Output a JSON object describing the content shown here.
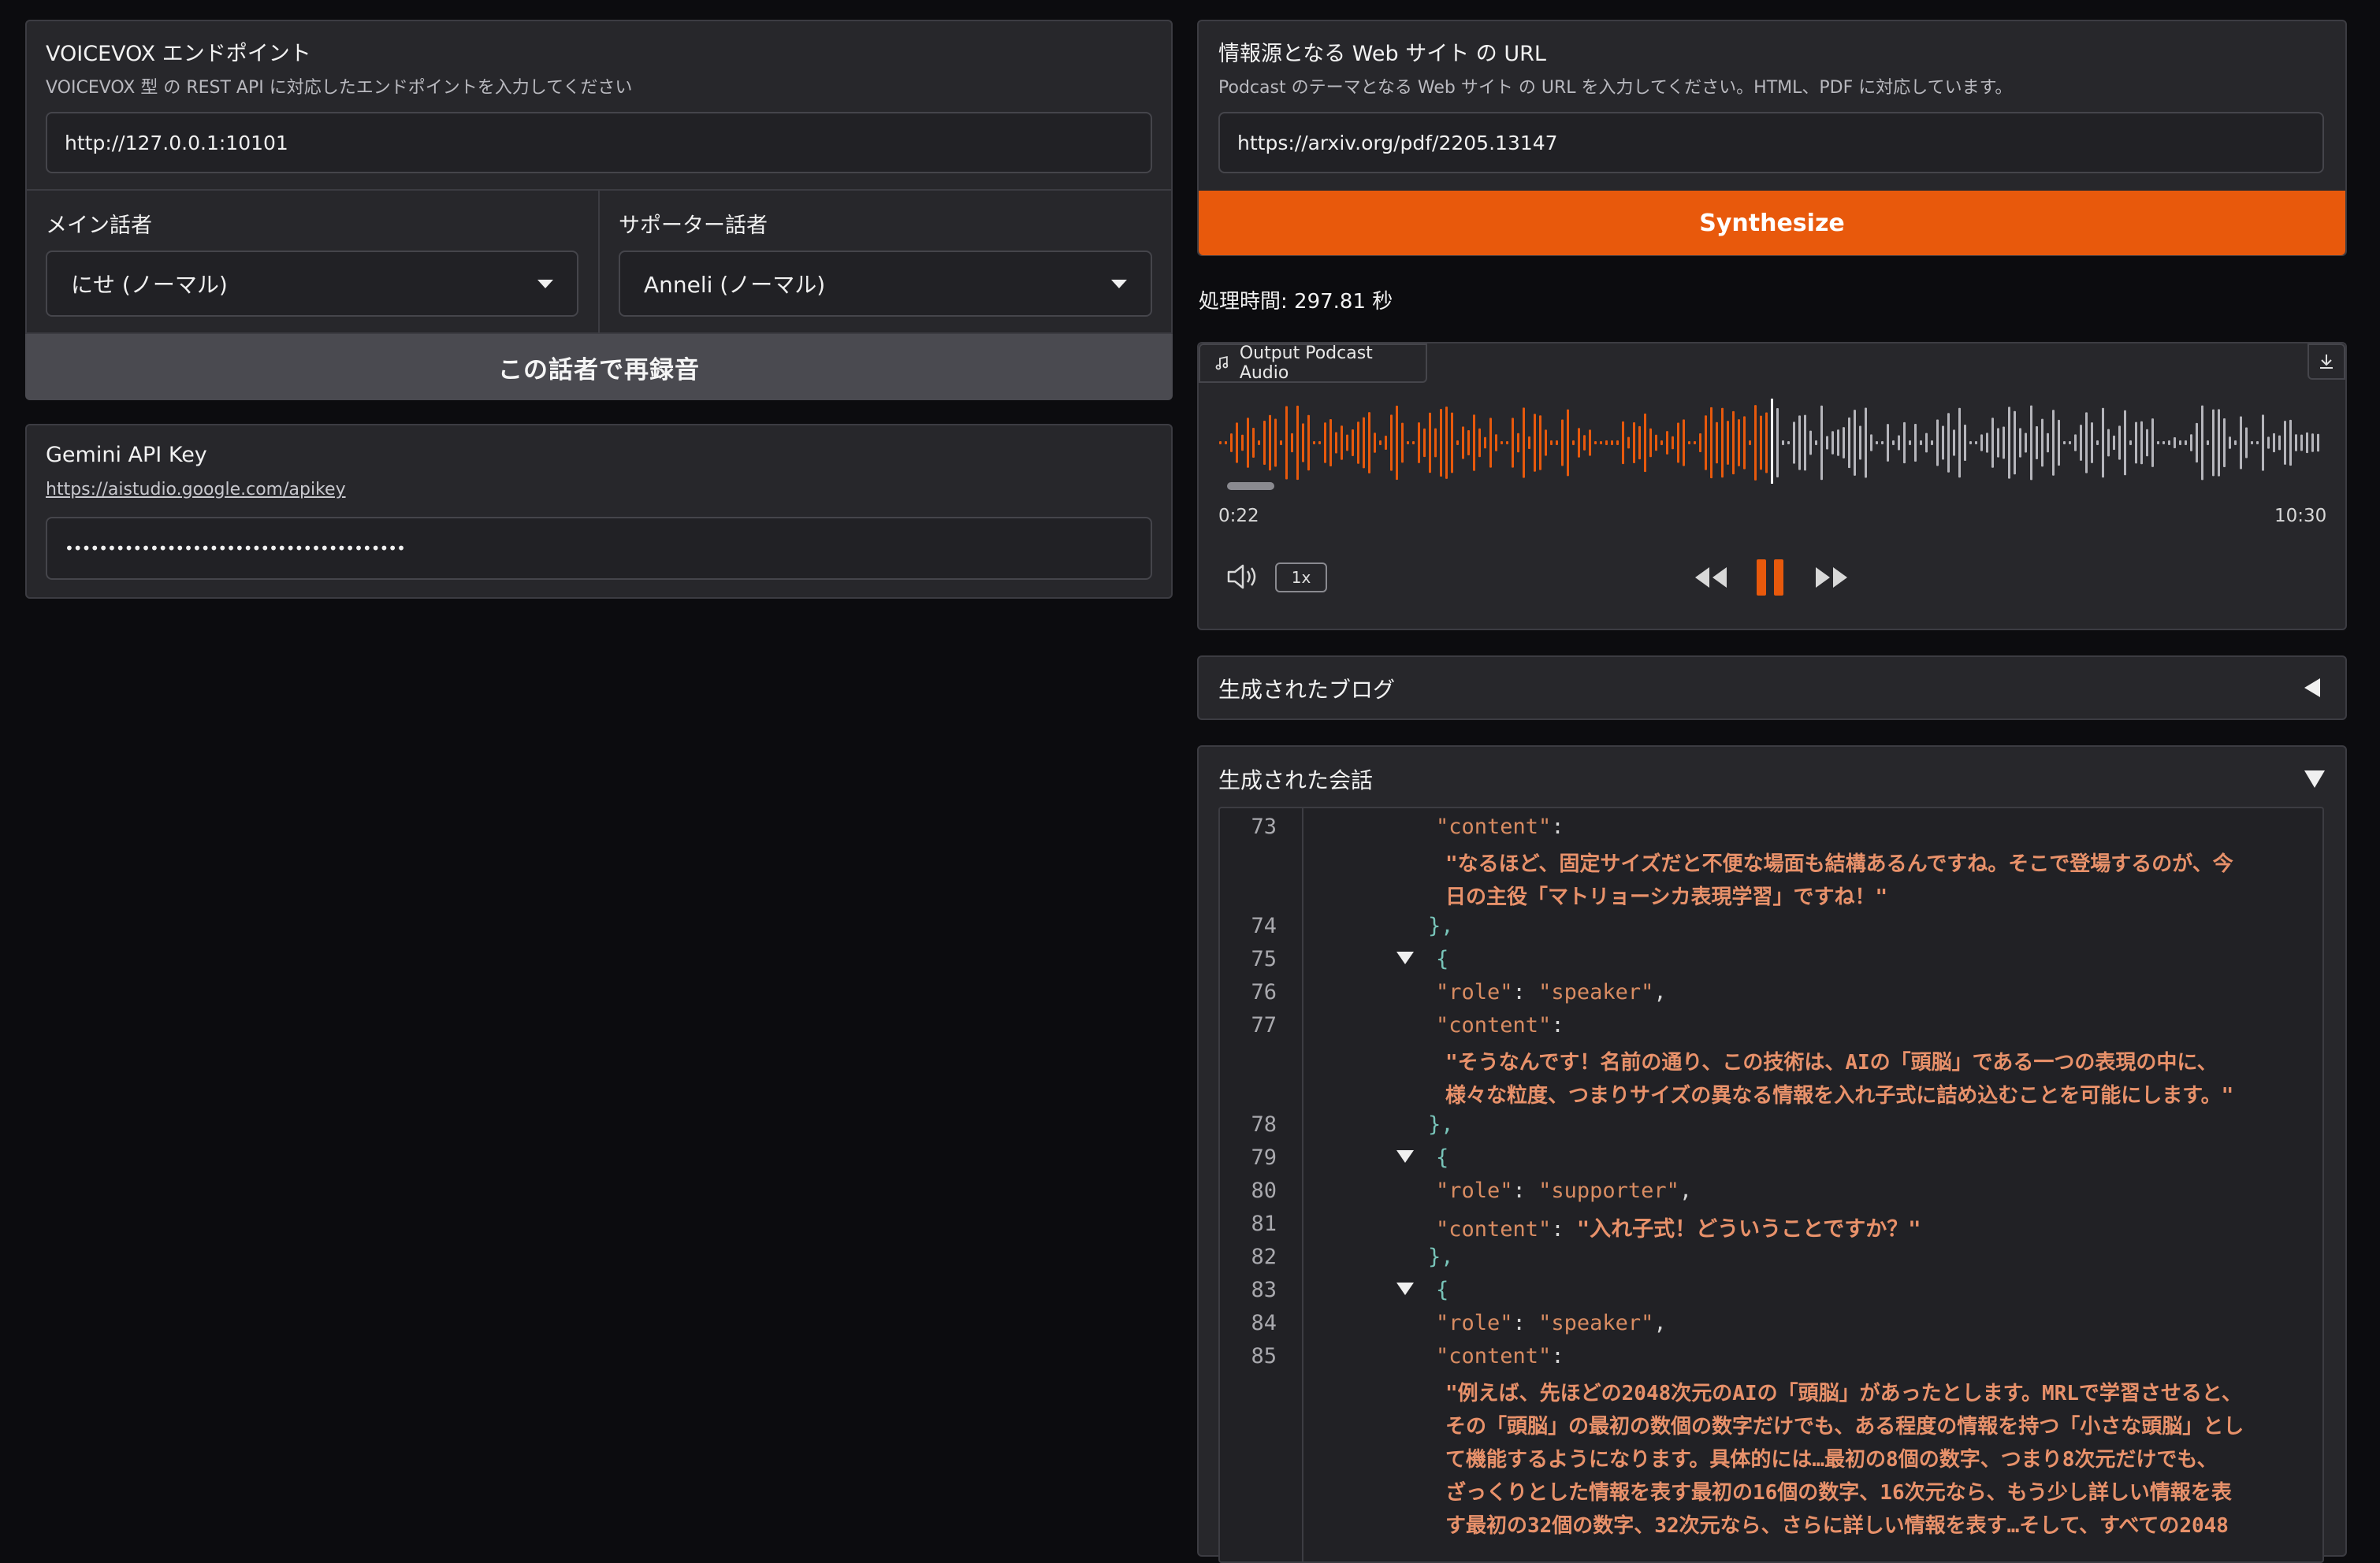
{
  "left": {
    "endpoint": {
      "label": "VOICEVOX エンドポイント",
      "info": "VOICEVOX 型 の REST API に対応したエンドポイントを入力してください",
      "value": "http://127.0.0.1:10101"
    },
    "main_speaker": {
      "label": "メイン話者",
      "value": "にせ (ノーマル)"
    },
    "support_speaker": {
      "label": "サポーター話者",
      "value": "Anneli (ノーマル)"
    },
    "rerecord_button": "この話者で再録音",
    "gemini": {
      "label": "Gemini API Key",
      "link": "https://aistudio.google.com/apikey",
      "value": "••••••••••••••••••••••••••••••••••••••••"
    }
  },
  "right": {
    "url": {
      "label": "情報源となる Web サイト の URL",
      "info": "Podcast のテーマとなる Web サイト の URL を入力してください。HTML、PDF に対応しています。",
      "value": "https://arxiv.org/pdf/2205.13147"
    },
    "synthesize_button": "Synthesize",
    "processing_time": "処理時間: 297.81 秒",
    "audio": {
      "label": "Output Podcast Audio",
      "current_time": "0:22",
      "duration": "10:30",
      "playback_rate": "1x",
      "progress": 0.5
    },
    "blog_accordion": {
      "label": "生成されたブログ",
      "icon": "triangle-left-icon"
    },
    "conversation_accordion": {
      "label": "生成された会話",
      "icon": "triangle-down-icon"
    },
    "code": {
      "line_numbers": [
        "73",
        "74",
        "75",
        "76",
        "77",
        "78",
        "79",
        "80",
        "81",
        "82",
        "83",
        "84",
        "85"
      ],
      "l73_key": "\"content\"",
      "l73_colon": ":",
      "l73_v1": "\"なるほど、固定サイズだと不便な場面も結構あるんですね。そこで登場するのが、今",
      "l73_v2": "日の主役「マトリョーシカ表現学習」ですね！\"",
      "close1": "},",
      "open1": "{",
      "l76_key": "\"role\"",
      "l76_sep": ": ",
      "l76_val": "\"speaker\"",
      "l76_comma": ",",
      "l77_key": "\"content\"",
      "l77_colon": ":",
      "l77_v1": "\"そうなんです！名前の通り、この技術は、AIの「頭脳」である一つの表現の中に、",
      "l77_v2": "様々な粒度、つまりサイズの異なる情報を入れ子式に詰め込むことを可能にします。\"",
      "close2": "},",
      "open2": "{",
      "l80_key": "\"role\"",
      "l80_sep": ": ",
      "l80_val": "\"supporter\"",
      "l80_comma": ",",
      "l81_key": "\"content\"",
      "l81_sep": ": ",
      "l81_val": "\"入れ子式！どういうことですか？\"",
      "close3": "},",
      "open3": "{",
      "l84_key": "\"role\"",
      "l84_sep": ": ",
      "l84_val": "\"speaker\"",
      "l84_comma": ",",
      "l85_key": "\"content\"",
      "l85_colon": ":",
      "l85_v1": "\"例えば、先ほどの2048次元のAIの「頭脳」があったとします。MRLで学習させると、",
      "l85_v2": "その「頭脳」の最初の数個の数字だけでも、ある程度の情報を持つ「小さな頭脳」とし",
      "l85_v3": "て機能するようになります。具体的には…最初の8個の数字、つまり8次元だけでも、",
      "l85_v4": "ざっくりとした情報を表す最初の16個の数字、16次元なら、もう少し詳しい情報を表",
      "l85_v5": "す最初の32個の数字、32次元なら、さらに詳しい情報を表す…そして、すべての2048"
    }
  },
  "colors": {
    "accent": "#e8590c",
    "background": "#0c0c0f",
    "panel": "#27272b"
  }
}
